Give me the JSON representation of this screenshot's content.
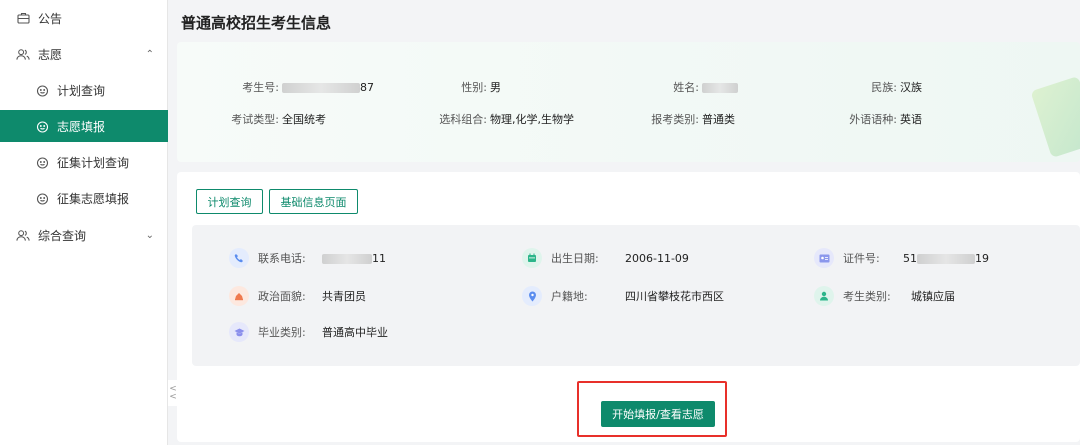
{
  "sidebar": {
    "items": [
      {
        "label": "公告"
      },
      {
        "label": "志愿",
        "chevron": "⌃"
      },
      {
        "label": "计划查询"
      },
      {
        "label": "志愿填报"
      },
      {
        "label": "征集计划查询"
      },
      {
        "label": "征集志愿填报"
      },
      {
        "label": "综合查询",
        "chevron": "⌄"
      }
    ]
  },
  "page": {
    "title": "普通高校招生考生信息"
  },
  "basic_info": {
    "exam_no": {
      "label": "考生号:",
      "value_suffix": "87"
    },
    "gender": {
      "label": "性别:",
      "value": "男"
    },
    "name": {
      "label": "姓名:"
    },
    "ethnicity": {
      "label": "民族:",
      "value": "汉族"
    },
    "exam_type": {
      "label": "考试类型:",
      "value": "全国统考"
    },
    "subjects": {
      "label": "选科组合:",
      "value": "物理,化学,生物学"
    },
    "apply_category": {
      "label": "报考类别:",
      "value": "普通类"
    },
    "foreign_lang": {
      "label": "外语语种:",
      "value": "英语"
    }
  },
  "buttons": {
    "plan_query": "计划查询",
    "basic_info_page": "基础信息页面",
    "start_fill": "开始填报/查看志愿"
  },
  "details": {
    "phone": {
      "label": "联系电话:",
      "value_suffix": "11",
      "icon": "phone-icon",
      "color": "#5b8def"
    },
    "birth": {
      "label": "出生日期:",
      "value": "2006-11-09",
      "icon": "calendar-icon",
      "color": "#2bb58a"
    },
    "id_no": {
      "label": "证件号:",
      "value_prefix": "51",
      "value_suffix": "19",
      "icon": "id-card-icon",
      "color": "#6b7be6"
    },
    "political": {
      "label": "政治面貌:",
      "value": "共青团员",
      "icon": "flag-icon",
      "color": "#ef7a4f"
    },
    "household": {
      "label": "户籍地:",
      "value": "四川省攀枝花市西区",
      "icon": "location-icon",
      "color": "#5b8def"
    },
    "candidate_type": {
      "label": "考生类别:",
      "value": "城镇应届",
      "icon": "user-icon",
      "color": "#2bb58a"
    },
    "grad_type": {
      "label": "毕业类别:",
      "value": "普通高中毕业",
      "icon": "graduation-cap-icon",
      "color": "#7a7fe6"
    }
  },
  "collapse_handle": {
    "glyph_top": "<",
    "glyph_bottom": "<"
  }
}
